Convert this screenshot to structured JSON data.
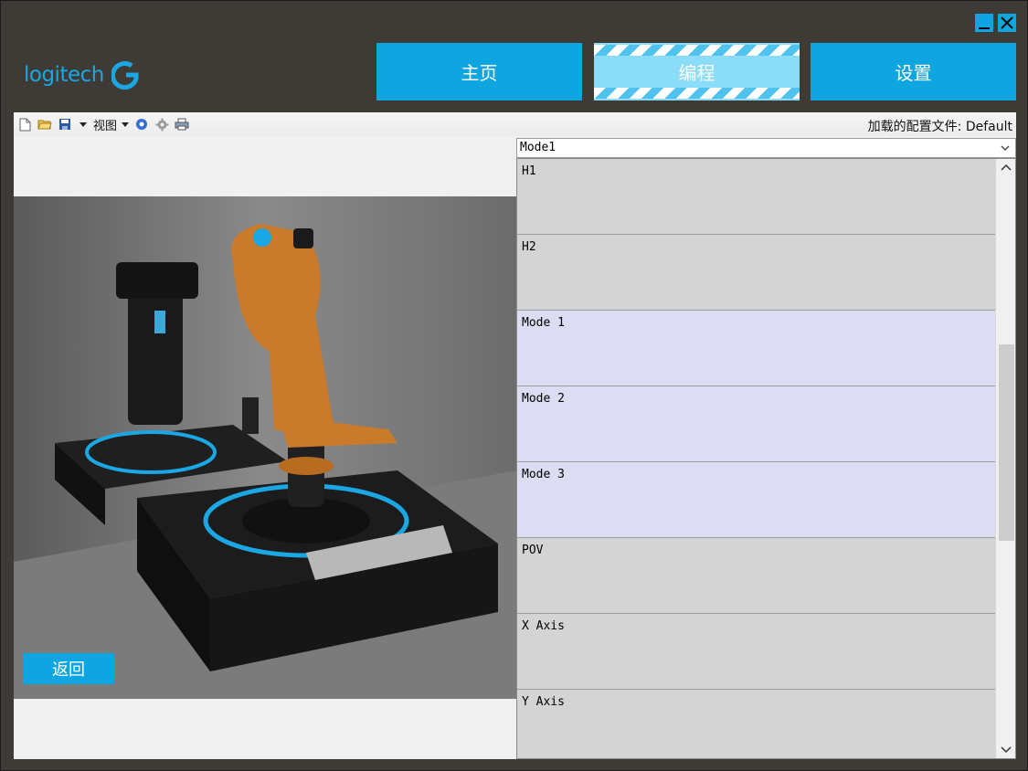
{
  "window": {
    "minimize_icon": "minimize-icon",
    "close_icon": "close-icon"
  },
  "logo": {
    "text": "logitech"
  },
  "nav": {
    "home": "主页",
    "program": "编程",
    "settings": "设置",
    "active": "program"
  },
  "toolbar": {
    "view_label": "视图",
    "profile_label": "加载的配置文件: Default"
  },
  "back_button": "返回",
  "mode_selector": {
    "selected": "Mode1"
  },
  "list": {
    "items": [
      {
        "label": "H1",
        "kind": "gray"
      },
      {
        "label": "H2",
        "kind": "gray"
      },
      {
        "label": "Mode 1",
        "kind": "mode"
      },
      {
        "label": "Mode 2",
        "kind": "mode"
      },
      {
        "label": "Mode 3",
        "kind": "mode"
      },
      {
        "label": "POV",
        "kind": "gray"
      },
      {
        "label": "X Axis",
        "kind": "gray"
      },
      {
        "label": "Y Axis",
        "kind": "gray"
      }
    ]
  },
  "colors": {
    "accent": "#0fa5e0",
    "active_tab": "#8bdcf8",
    "frame": "#3e3b36",
    "mode_row": "#dcdcf2"
  }
}
